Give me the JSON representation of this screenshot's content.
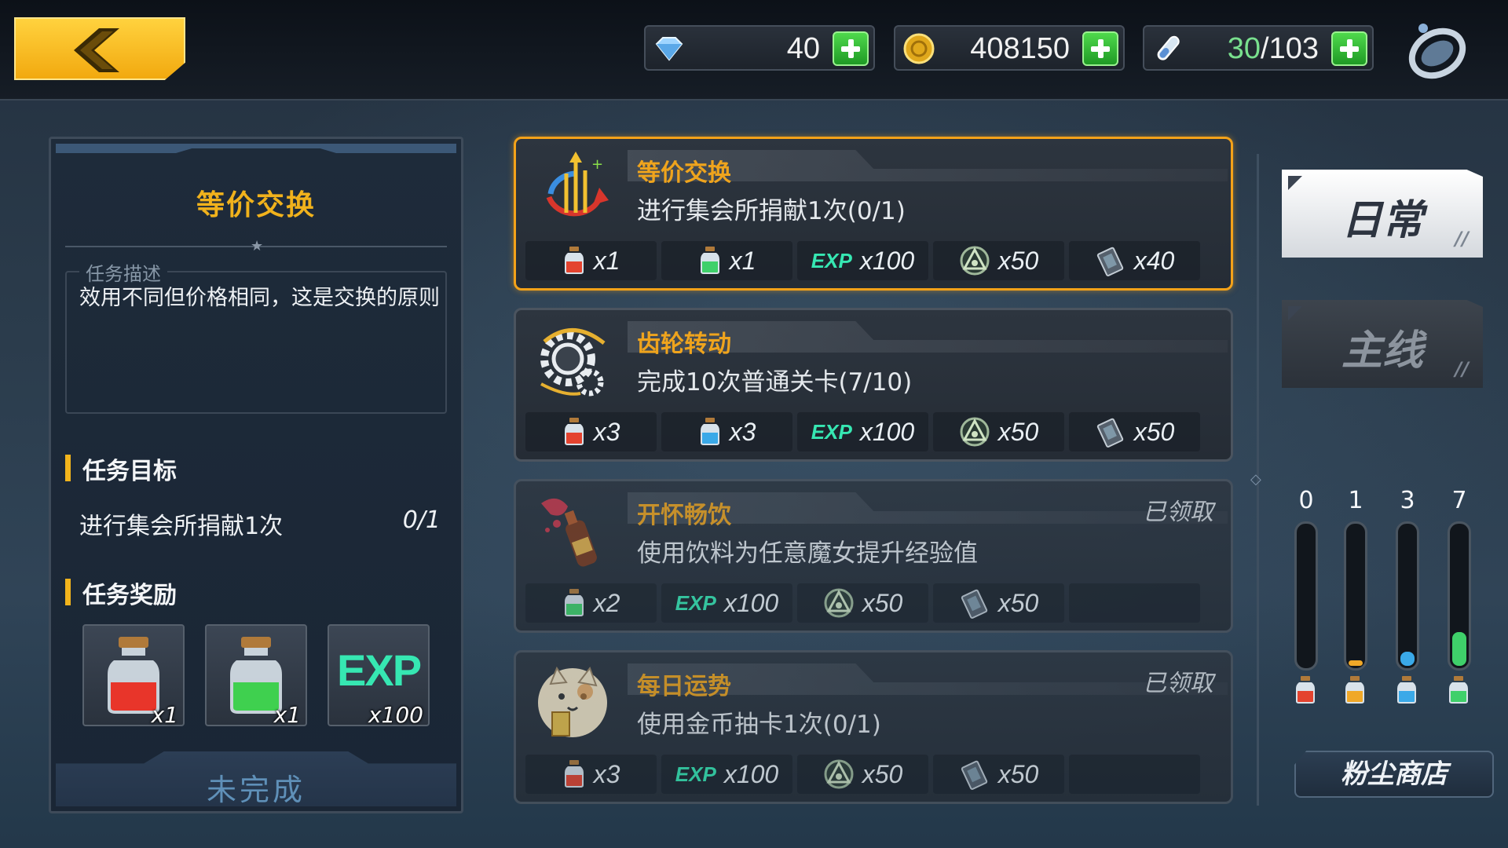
{
  "topbar": {
    "back_icon": "chevron-left-icon",
    "gems": "40",
    "gold": "408150",
    "stamina_current": "30",
    "stamina_max": "/103",
    "settings_icon": "ring-icon"
  },
  "left_panel": {
    "title": "等价交换",
    "desc_label": "任务描述",
    "desc_text": "效用不同但价格相同，这是交换的原则",
    "goal_heading": "任务目标",
    "goal_text": "进行集会所捐献1次",
    "goal_progress": "0/1",
    "reward_heading": "任务奖励",
    "rewards": [
      {
        "icon": "red-potion-icon",
        "qty": "x1"
      },
      {
        "icon": "green-potion-icon",
        "qty": "x1"
      },
      {
        "icon": "exp-icon",
        "label": "EXP",
        "qty": "x100"
      }
    ],
    "status": "未完成"
  },
  "missions": [
    {
      "title": "等价交换",
      "desc": "进行集会所捐献1次(0/1)",
      "claimed": "",
      "rewards": [
        {
          "kind": "potion",
          "color": "#e4432f",
          "qty": "x1"
        },
        {
          "kind": "potion",
          "color": "#3fd06a",
          "qty": "x1"
        },
        {
          "kind": "exp",
          "label": "EXP",
          "qty": "x100"
        },
        {
          "kind": "emblem",
          "qty": "x50"
        },
        {
          "kind": "card",
          "qty": "x40"
        }
      ]
    },
    {
      "title": "齿轮转动",
      "desc": "完成10次普通关卡(7/10)",
      "claimed": "",
      "rewards": [
        {
          "kind": "potion",
          "color": "#e4432f",
          "qty": "x3"
        },
        {
          "kind": "potion",
          "color": "#3aa9e8",
          "qty": "x3"
        },
        {
          "kind": "exp",
          "label": "EXP",
          "qty": "x100"
        },
        {
          "kind": "emblem",
          "qty": "x50"
        },
        {
          "kind": "card",
          "qty": "x50"
        }
      ]
    },
    {
      "title": "开怀畅饮",
      "desc": "使用饮料为任意魔女提升经验值",
      "claimed": "已领取",
      "rewards": [
        {
          "kind": "potion",
          "color": "#3fd06a",
          "qty": "x2"
        },
        {
          "kind": "exp",
          "label": "EXP",
          "qty": "x100"
        },
        {
          "kind": "emblem",
          "qty": "x50"
        },
        {
          "kind": "card",
          "qty": "x50"
        }
      ]
    },
    {
      "title": "每日运势",
      "desc": "使用金币抽卡1次(0/1)",
      "claimed": "已领取",
      "rewards": [
        {
          "kind": "potion",
          "color": "#e4432f",
          "qty": "x3"
        },
        {
          "kind": "exp",
          "label": "EXP",
          "qty": "x100"
        },
        {
          "kind": "emblem",
          "qty": "x50"
        },
        {
          "kind": "card",
          "qty": "x50"
        }
      ]
    }
  ],
  "tabs": {
    "daily": "日常",
    "main": "主线"
  },
  "meters": [
    {
      "count": "0",
      "color": "#e4432f",
      "fill": 0.0
    },
    {
      "count": "1",
      "color": "#f0a828",
      "fill": 0.04
    },
    {
      "count": "3",
      "color": "#3aa9e8",
      "fill": 0.1
    },
    {
      "count": "7",
      "color": "#3fd06a",
      "fill": 0.24
    }
  ],
  "shop_button": "粉尘商店"
}
